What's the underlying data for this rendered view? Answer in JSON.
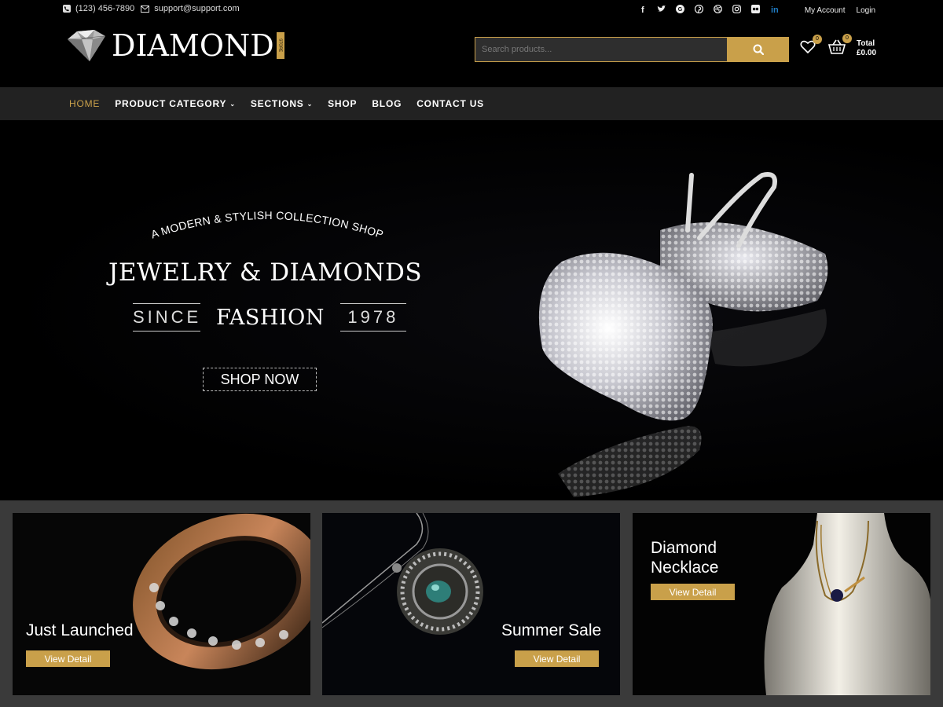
{
  "topbar": {
    "phone": "(123) 456-7890",
    "email": "support@support.com",
    "social": [
      "f",
      "t",
      "g",
      "p",
      "d",
      "i",
      "fl",
      "in"
    ],
    "my_account": "My Account",
    "login": "Login"
  },
  "header": {
    "logo_text": "DIAMOND",
    "logo_sub": "STORE",
    "search_placeholder": "Search products...",
    "wishlist_count": "0",
    "cart_count": "0",
    "cart_total_label": "Total",
    "cart_total_value": "£0.00"
  },
  "nav": {
    "items": [
      {
        "label": "HOME",
        "active": true
      },
      {
        "label": "PRODUCT CATEGORY"
      },
      {
        "label": "SECTIONS"
      },
      {
        "label": "SHOP"
      },
      {
        "label": "BLOG"
      },
      {
        "label": "CONTACT US"
      }
    ]
  },
  "hero": {
    "arc_text": "A MODERN & STYLISH COLLECTION SHOP",
    "title": "JEWELRY & DIAMONDS",
    "since": "SINCE",
    "fashion": "FASHION",
    "year": "1978",
    "cta": "SHOP NOW"
  },
  "banners": [
    {
      "title": "Just Launched",
      "cta": "View Detail"
    },
    {
      "title": "Summer Sale",
      "cta": "View Detail"
    },
    {
      "title": "Diamond Necklace",
      "title_line1": "Diamond",
      "title_line2": "Necklace",
      "cta": "View Detail"
    }
  ],
  "colors": {
    "accent": "#c9a04a",
    "nav_bg": "#222222",
    "banner_strip_bg": "#3a3a3a"
  }
}
